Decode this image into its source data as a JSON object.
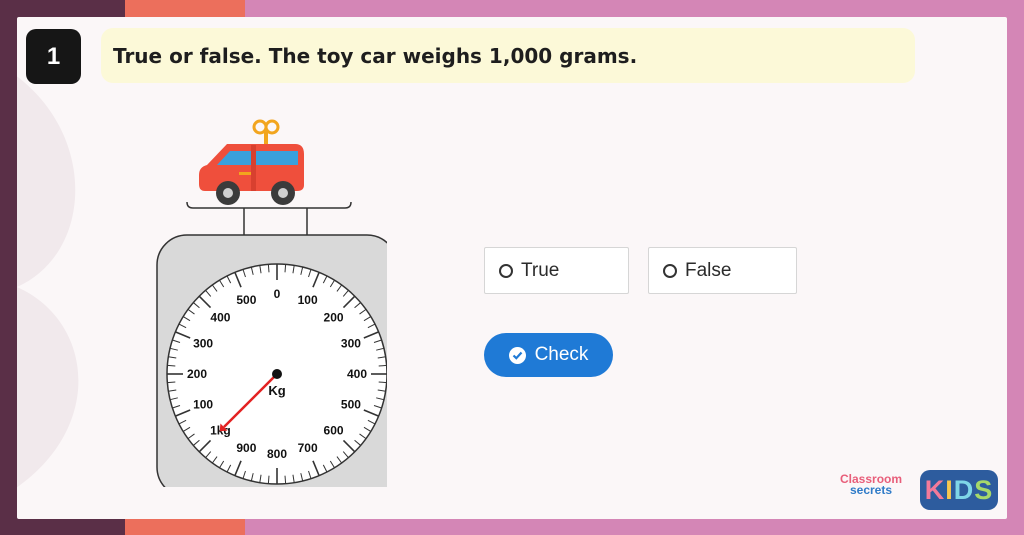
{
  "question": {
    "number": "1",
    "text": "True or false. The toy car weighs 1,000 grams."
  },
  "scale": {
    "labels_right": [
      "0",
      "100",
      "200",
      "300",
      "400",
      "500",
      "600",
      "700"
    ],
    "labels_left": [
      "800",
      "900",
      "1kg",
      "100",
      "200",
      "300",
      "400",
      "500"
    ],
    "unit": "Kg",
    "reading_kg": 1
  },
  "options": [
    {
      "label": "True"
    },
    {
      "label": "False"
    }
  ],
  "check_button": {
    "label": "Check"
  },
  "branding": {
    "cs_line1": "Classroom",
    "cs_line2": "secrets",
    "kids": "KIDS",
    "kids_colors": [
      "#f27a9a",
      "#f9c74f",
      "#7fd6e8",
      "#a6d96a"
    ]
  },
  "colors": {
    "dark_bg": "#5a2f47",
    "orange_bg": "#ec6f5c",
    "pink_bg": "#d486b6",
    "question_bg": "#fcf9d8",
    "check_blue": "#1f7ad6",
    "pointer_red": "#e32222",
    "car_red": "#ef4f3c"
  }
}
